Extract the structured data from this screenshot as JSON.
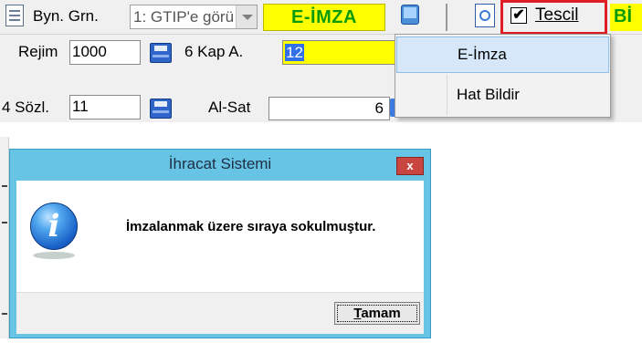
{
  "toolbar": {
    "beyan_label": "Byn. Grn.",
    "beyan_combo_value": "1: GTIP'e görü",
    "eimza_button": "E-İMZA",
    "tescil_label": "Tescil",
    "tescil_checked": "✔",
    "bi_button": "Bİ"
  },
  "form": {
    "rejim_label": "Rejim",
    "rejim_value": "1000",
    "kapa_label": "6 Kap A.",
    "kapa_value": "12",
    "sozl_label": "4 Sözl.",
    "sozl_value": "11",
    "alsat_label": "Al-Sat",
    "alsat_value": "6"
  },
  "menu": {
    "items": [
      {
        "label": "E-İmza"
      },
      {
        "label": "Hat Bildir"
      }
    ]
  },
  "dialog": {
    "title": "İhracat Sistemi",
    "close": "x",
    "message": "İmzalanmak üzere sıraya sokulmuştur.",
    "ok_first": "T",
    "ok_rest": "amam"
  },
  "colors": {
    "eimza_bg": "#ffff00",
    "eimza_text": "#0a9a0a",
    "highlight_border": "#e01c24",
    "dialog_frame": "#67c4e4"
  },
  "icons": [
    "document-icon",
    "dropdown-arrow-icon",
    "blue-box-icon",
    "page-icon",
    "save-icon",
    "info-icon",
    "close-icon"
  ]
}
